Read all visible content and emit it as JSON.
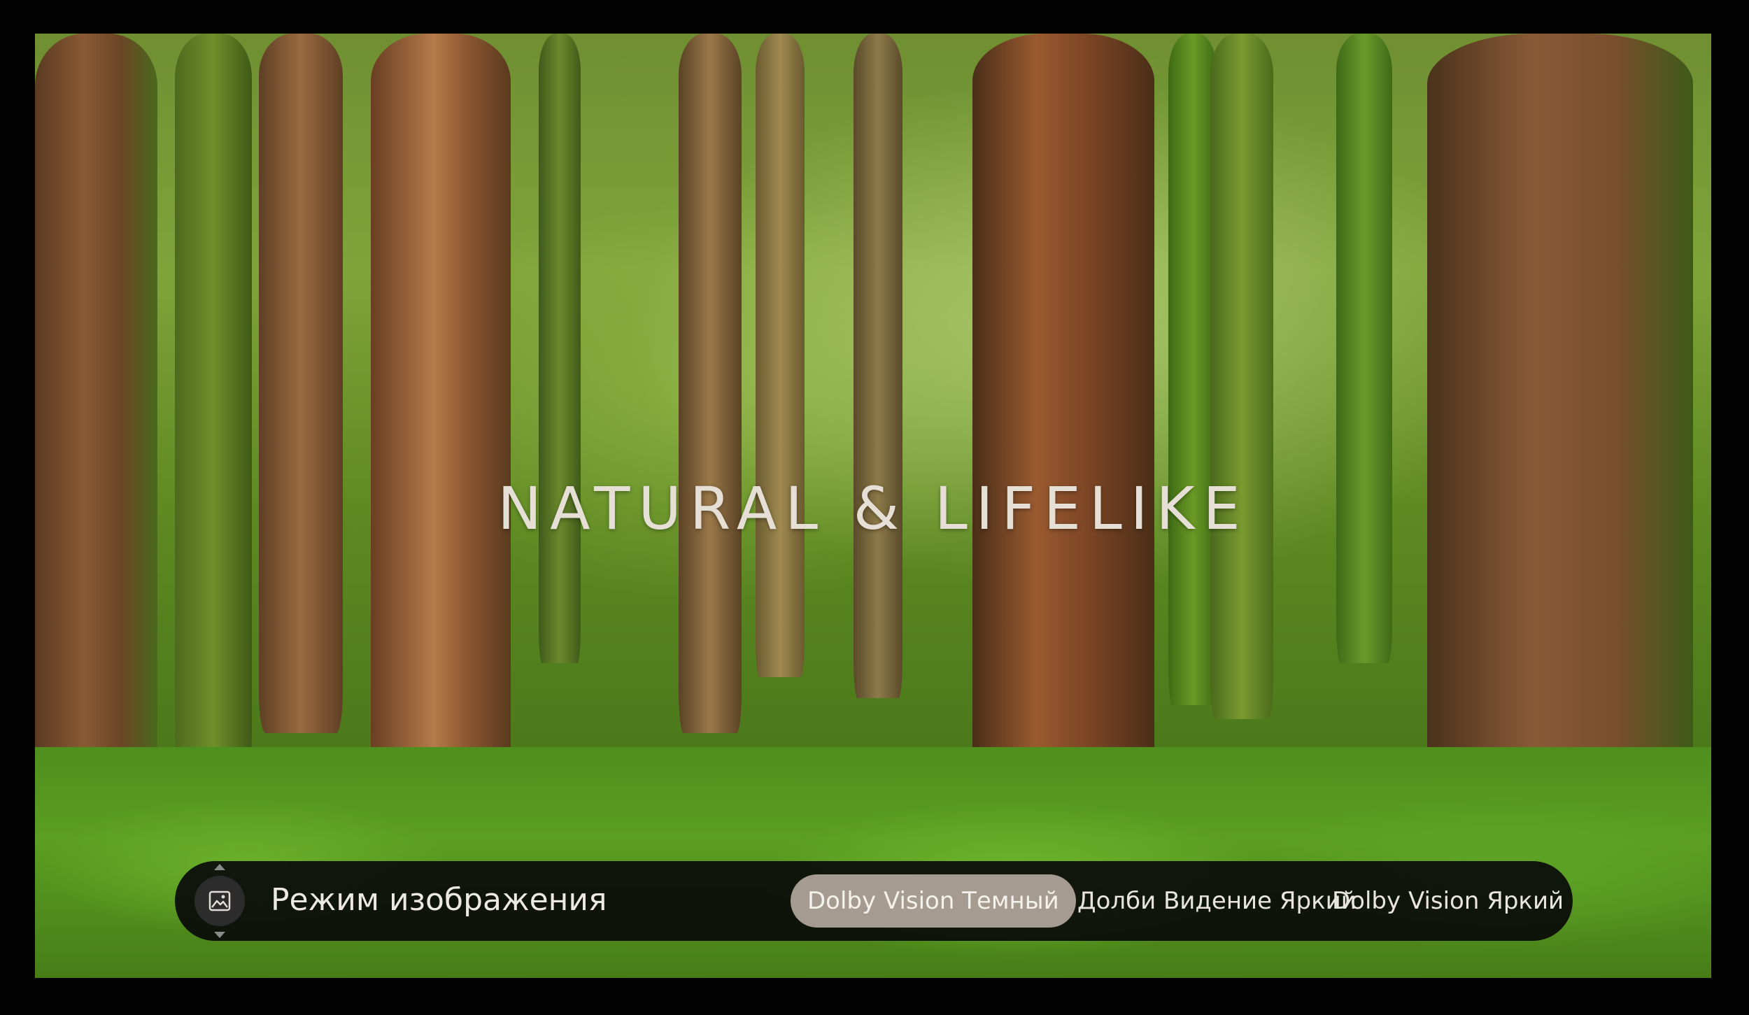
{
  "screen": {
    "headline": "NATURAL & LIFELIKE"
  },
  "picture_mode_menu": {
    "title": "Режим изображения",
    "icon": "picture-icon",
    "options": [
      {
        "label": "Dolby Vision Темный",
        "selected": true
      },
      {
        "label": "Долби Видение Яркий",
        "selected": false
      },
      {
        "label": "Dolby Vision Яркий",
        "selected": false
      }
    ]
  },
  "colors": {
    "menu_background": "#0a0a0a",
    "selected_option": "#a69b90",
    "headline_text": "#e6dfd6"
  }
}
